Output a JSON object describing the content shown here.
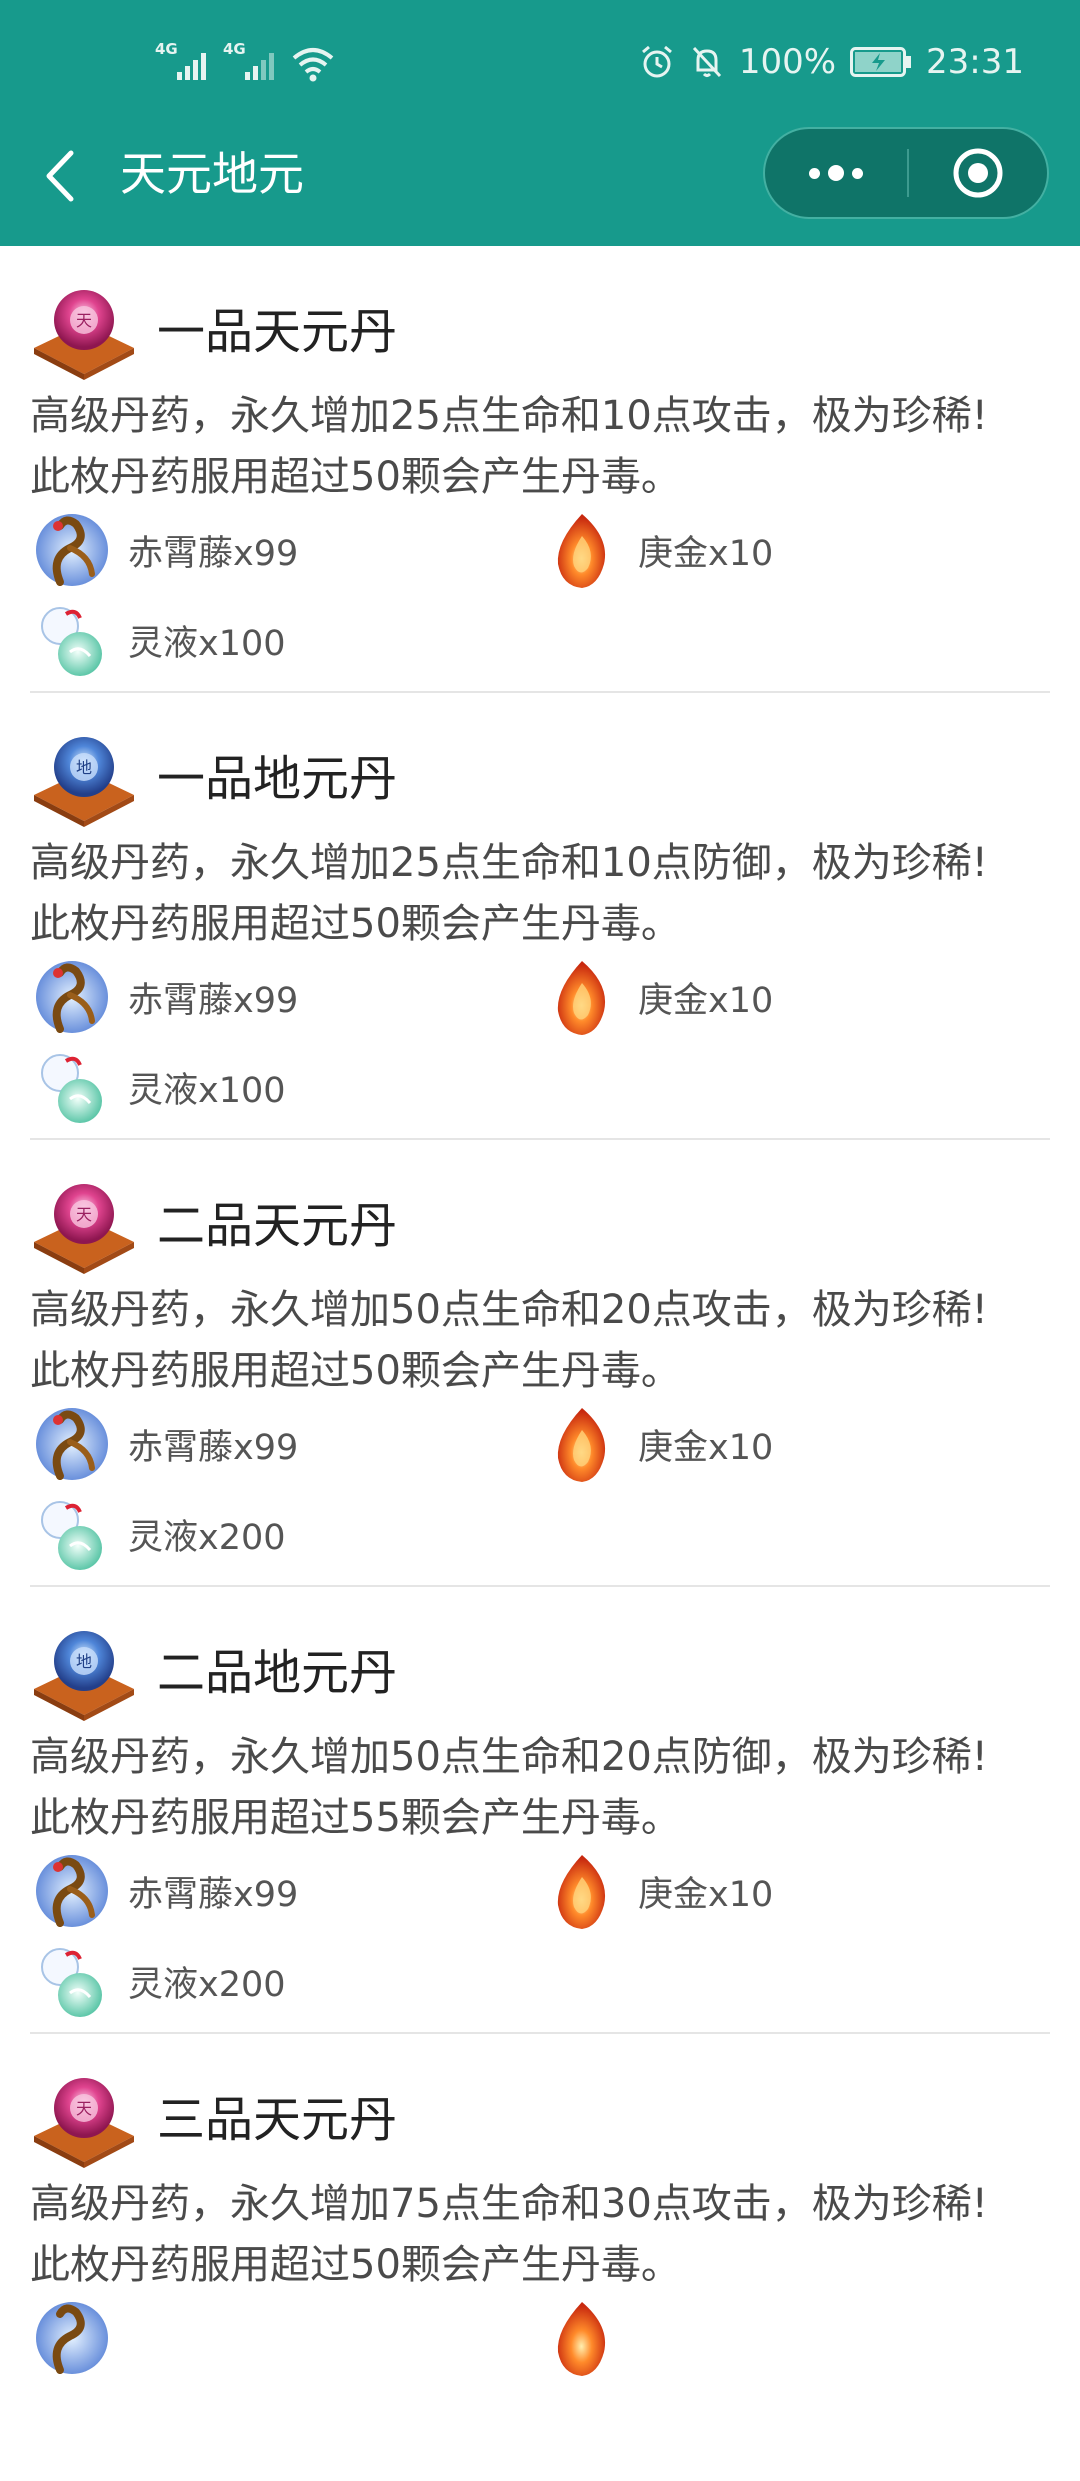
{
  "status_bar": {
    "network_1": "4G",
    "network_2": "4G",
    "battery_percent": "100%",
    "time": "23:31",
    "icons": [
      "signal-icon",
      "signal-icon",
      "wifi-icon",
      "alarm-icon",
      "mute-icon",
      "battery-charging-icon"
    ]
  },
  "nav": {
    "title": "天元地元",
    "back_icon": "chevron-left-icon",
    "more_icon": "more-icon",
    "close_icon": "target-close-icon"
  },
  "colors": {
    "theme": "#179a8c",
    "capsule": "#0f7468"
  },
  "items": [
    {
      "name": "一品天元丹",
      "type": "tian",
      "desc_line1": "高级丹药，永久增加25点生命和10点攻击，极为珍稀!",
      "desc_line2": "此枚丹药服用超过50颗会产生丹毒。",
      "materials": [
        {
          "label": "赤霄藤x99",
          "icon": "vine-icon"
        },
        {
          "label": "庚金x10",
          "icon": "flame-gem-icon"
        },
        {
          "label": "灵液x100",
          "icon": "spirit-liquid-icon"
        }
      ]
    },
    {
      "name": "一品地元丹",
      "type": "di",
      "desc_line1": "高级丹药，永久增加25点生命和10点防御，极为珍稀!",
      "desc_line2": "此枚丹药服用超过50颗会产生丹毒。",
      "materials": [
        {
          "label": "赤霄藤x99",
          "icon": "vine-icon"
        },
        {
          "label": "庚金x10",
          "icon": "flame-gem-icon"
        },
        {
          "label": "灵液x100",
          "icon": "spirit-liquid-icon"
        }
      ]
    },
    {
      "name": "二品天元丹",
      "type": "tian",
      "desc_line1": "高级丹药，永久增加50点生命和20点攻击，极为珍稀!",
      "desc_line2": "此枚丹药服用超过50颗会产生丹毒。",
      "materials": [
        {
          "label": "赤霄藤x99",
          "icon": "vine-icon"
        },
        {
          "label": "庚金x10",
          "icon": "flame-gem-icon"
        },
        {
          "label": "灵液x200",
          "icon": "spirit-liquid-icon"
        }
      ]
    },
    {
      "name": "二品地元丹",
      "type": "di",
      "desc_line1": "高级丹药，永久增加50点生命和20点防御，极为珍稀!",
      "desc_line2": "此枚丹药服用超过55颗会产生丹毒。",
      "materials": [
        {
          "label": "赤霄藤x99",
          "icon": "vine-icon"
        },
        {
          "label": "庚金x10",
          "icon": "flame-gem-icon"
        },
        {
          "label": "灵液x200",
          "icon": "spirit-liquid-icon"
        }
      ]
    },
    {
      "name": "三品天元丹",
      "type": "tian",
      "desc_line1": "高级丹药，永久增加75点生命和30点攻击，极为珍稀!",
      "desc_line2": "此枚丹药服用超过50颗会产生丹毒。",
      "materials": [
        {
          "label": "",
          "icon": "vine-icon"
        },
        {
          "label": "",
          "icon": "flame-gem-icon"
        }
      ]
    }
  ]
}
